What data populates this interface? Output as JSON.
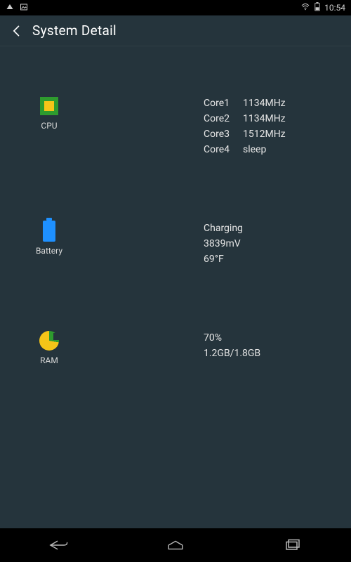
{
  "statusbar": {
    "time": "10:54"
  },
  "header": {
    "title": "System Detail"
  },
  "cpu": {
    "label": "CPU",
    "cores": [
      {
        "name": "Core1",
        "value": "1134MHz"
      },
      {
        "name": "Core2",
        "value": "1134MHz"
      },
      {
        "name": "Core3",
        "value": "1512MHz"
      },
      {
        "name": "Core4",
        "value": "sleep"
      }
    ]
  },
  "battery": {
    "label": "Battery",
    "lines": [
      "Charging",
      "3839mV",
      "69°F"
    ]
  },
  "ram": {
    "label": "RAM",
    "lines": [
      "70%",
      "1.2GB/1.8GB"
    ]
  }
}
